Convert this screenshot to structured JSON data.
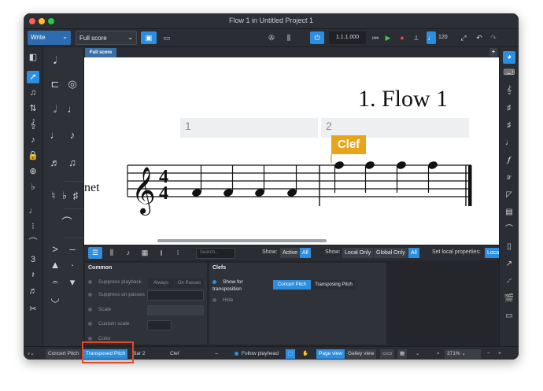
{
  "window": {
    "title": "Flow 1 in Untitled Project 1"
  },
  "toolbar": {
    "mode": "Write",
    "layout": "Full score",
    "position": "1.1.1.000",
    "tempo": "120"
  },
  "score": {
    "tab_label": "Full score",
    "flow_title": "1. Flow 1",
    "bar_numbers": [
      "1",
      "2"
    ],
    "instrument_label": "net",
    "time_signature": {
      "top": "4",
      "bottom": "4"
    },
    "popover_label": "Clef"
  },
  "properties_toolbar": {
    "search_placeholder": "Search...",
    "show_label": "Show:",
    "active": "Active",
    "all": "All",
    "local_only": "Local Only",
    "global_only": "Global Only",
    "set_local_label": "Set local properties:",
    "set_local_value": "Loca"
  },
  "common_group": {
    "title": "Common",
    "rows": [
      "Suppress playback",
      "Suppress on passes",
      "Scale",
      "Custom scale",
      "Color"
    ],
    "always": "Always",
    "on_passes": "On Passes"
  },
  "clefs_group": {
    "title": "Clefs",
    "show_for": "Show for transposition",
    "concert": "Concert Pitch",
    "transposing": "Transposing Pitch",
    "hide": "Hide"
  },
  "statusbar": {
    "concert_pitch": "Concert Pitch",
    "transposed_pitch": "Transposed Pitch",
    "bar": "Bar 2",
    "selection": "Clef",
    "follow": "Follow playhead",
    "page_view": "Page view",
    "galley_view": "Galley view",
    "zoom": "371%"
  },
  "colors": {
    "accent": "#2d8ee0",
    "popover": "#e8a51b",
    "highlight": "#e04a2a"
  }
}
